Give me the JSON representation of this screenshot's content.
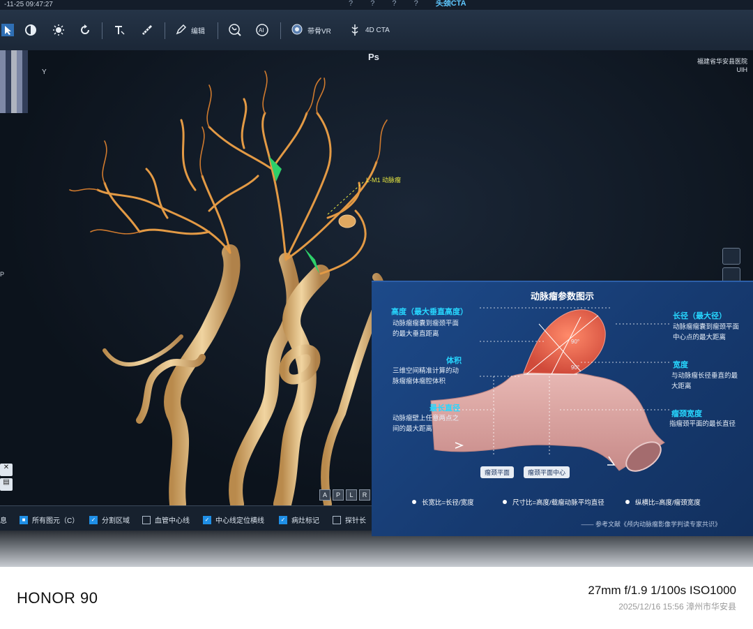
{
  "status_bar": {
    "datetime": "-11-25 09:47:27",
    "tabs": [
      "?",
      "?",
      "?",
      "?",
      "头颈CTA"
    ]
  },
  "toolbar": {
    "tools": [
      {
        "icon": "pointer-icon"
      },
      {
        "icon": "contrast-icon"
      },
      {
        "icon": "brightness-icon"
      },
      {
        "icon": "rotate-icon"
      },
      {
        "icon": "text-annotation-icon"
      },
      {
        "icon": "ruler-icon"
      },
      {
        "icon": "edit-icon",
        "label": "编辑"
      },
      {
        "icon": "vessel-icon"
      },
      {
        "icon": "ai-icon"
      },
      {
        "icon": "bone-vr-icon",
        "label": "带骨VR"
      },
      {
        "icon": "cta4d-icon",
        "label": "4D CTA"
      }
    ]
  },
  "viewport": {
    "orientation_label": "Ps",
    "hospital": "福建省华安县医院",
    "vendor": "UIH",
    "left_letter": "Y",
    "left_side_marker": "P",
    "aneurysm_label": "L-M1 动脉瘤",
    "orientation_buttons": [
      "A",
      "P",
      "L",
      "R"
    ]
  },
  "bottom_bar": {
    "items": [
      {
        "label": "息",
        "checked": false
      },
      {
        "label": "所有图元（C）",
        "checked": true
      },
      {
        "label": "分割区域",
        "checked": true
      },
      {
        "label": "血管中心线",
        "checked": false
      },
      {
        "label": "中心线定位横线",
        "checked": true
      },
      {
        "label": "病灶标记",
        "checked": true
      },
      {
        "label": "探针长",
        "checked": false
      }
    ]
  },
  "info_panel": {
    "title": "动脉瘤参数图示",
    "height_title": "高度（最大垂直高度）",
    "height_desc": [
      "动脉瘤瘤囊到瘤颈平面",
      "的最大垂直距离"
    ],
    "volume_title": "体积",
    "volume_desc": [
      "三维空间精准计算的动",
      "脉瘤瘤体瘤腔体积"
    ],
    "maxdiam_title": "最长直径",
    "maxdiam_desc": [
      "动脉瘤壁上任意两点之",
      "间的最大距离"
    ],
    "length_title": "长径（最大径）",
    "length_desc": [
      "动脉瘤瘤囊到瘤颈平面",
      "中心点的最大距离"
    ],
    "width_title": "宽度",
    "width_desc": [
      "与动脉瘤长径垂直的最",
      "大距离"
    ],
    "neck_title": "瘤颈宽度",
    "neck_desc": [
      "指瘤颈平面的最长直径"
    ],
    "angle_a": "90°",
    "angle_b": "90°",
    "tag_neck_plane": "瘤颈平面",
    "tag_neck_center": "瘤颈平面中心",
    "ratio_aspect": "长宽比=长径/宽度",
    "ratio_size": "尺寸比=高度/载瘤动脉平均直径",
    "ratio_hn": "纵横比=高度/瘤颈宽度",
    "reference": "—— 参考文献《颅内动脉瘤影像学判读专家共识》"
  },
  "photo_footer": {
    "device": "HONOR 90",
    "exif": "27mm  f/1.9  1/100s  ISO1000",
    "stamp": "2025/12/16 15:56  漳州市华安县"
  },
  "colors": {
    "vessel": "#d8893a",
    "panel_bg": "#1d4a8a",
    "heading_cyan": "#27d7ff",
    "aneurysm": "#e05a44"
  }
}
